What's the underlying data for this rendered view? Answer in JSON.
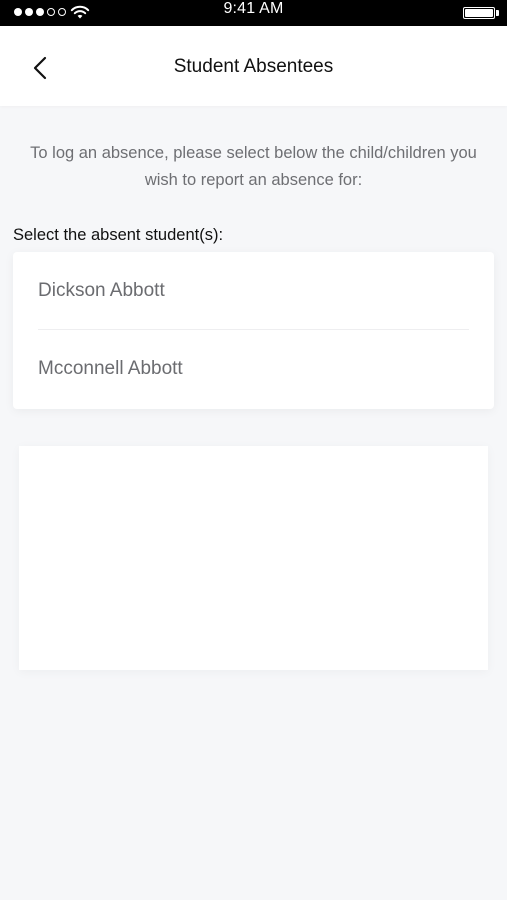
{
  "status_bar": {
    "time": "9:41 AM",
    "signal_filled": 3,
    "signal_total": 5,
    "battery_level": 1.0
  },
  "header": {
    "title": "Student Absentees",
    "back_icon": "chevron-left-icon"
  },
  "intro_text": "To log an absence, please select below the child/children you wish to report an absence for:",
  "select_label": "Select the absent student(s):",
  "students": [
    {
      "name": "Dickson Abbott"
    },
    {
      "name": "Mcconnell Abbott"
    }
  ],
  "colors": {
    "background": "#f6f7f9",
    "card": "#ffffff",
    "muted_text": "#6e6f73"
  }
}
